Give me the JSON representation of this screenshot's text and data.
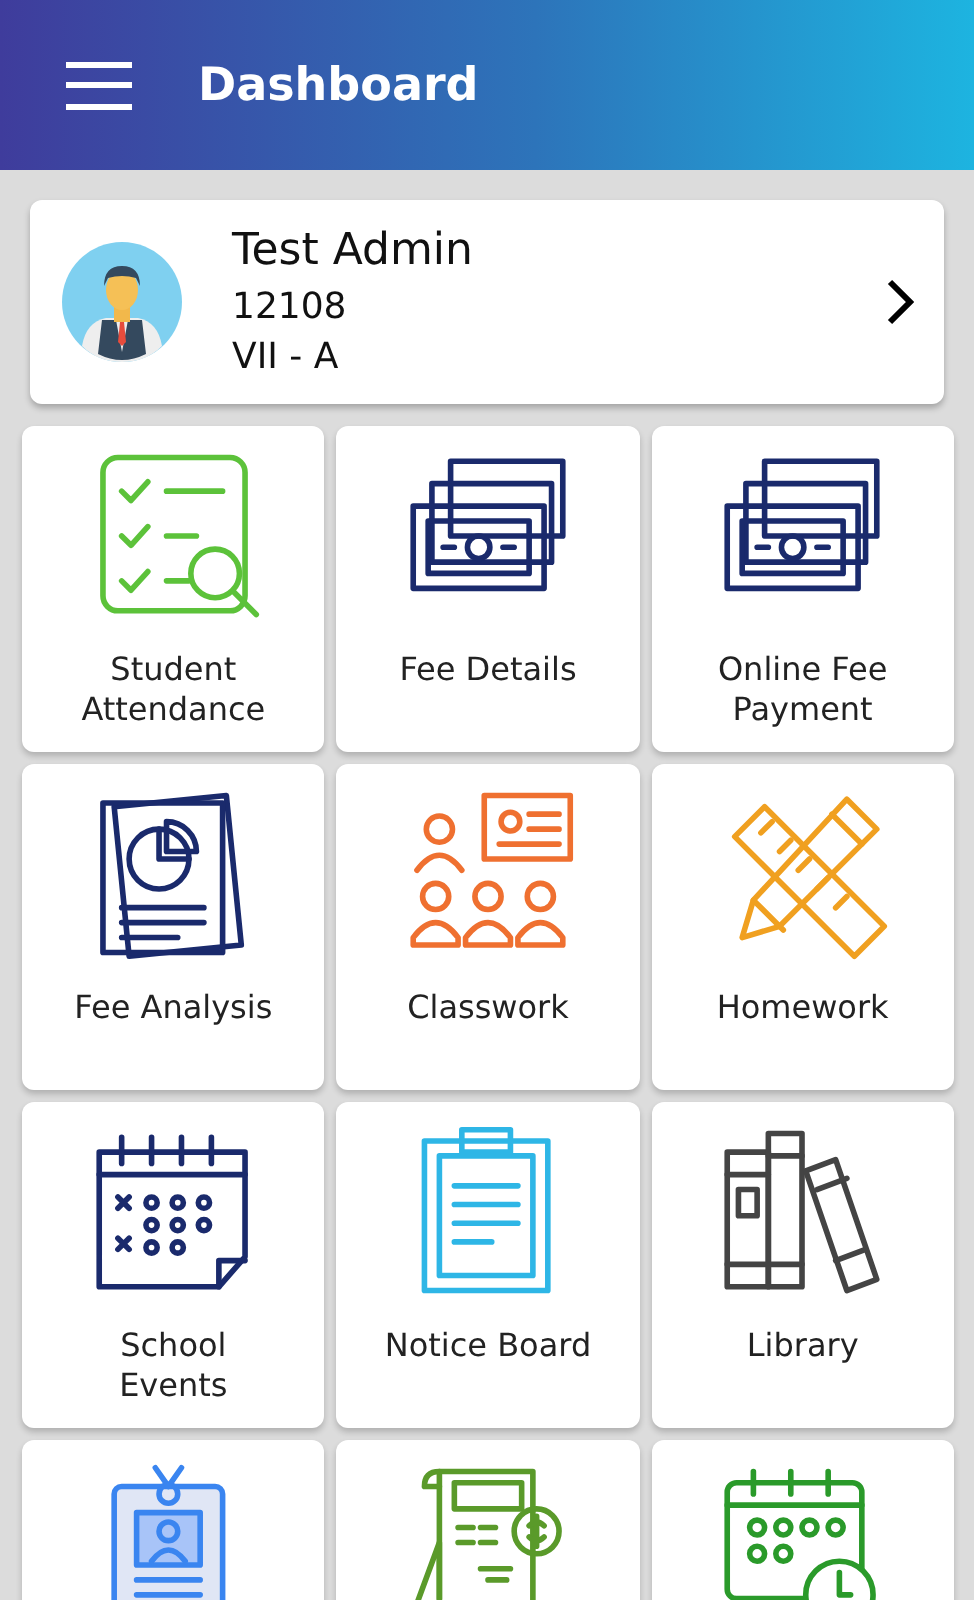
{
  "app_bar": {
    "title": "Dashboard"
  },
  "profile": {
    "name": "Test Admin",
    "id": "12108",
    "class": "VII - A"
  },
  "tiles": [
    {
      "kind": "attendance",
      "label": "Student Attendance"
    },
    {
      "kind": "cash",
      "label": "Fee Details"
    },
    {
      "kind": "cash",
      "label": "Online Fee Payment"
    },
    {
      "kind": "report",
      "label": "Fee Analysis"
    },
    {
      "kind": "class",
      "label": "Classwork"
    },
    {
      "kind": "tools",
      "label": "Homework"
    },
    {
      "kind": "calendar",
      "label": "School Events"
    },
    {
      "kind": "clipboard",
      "label": "Notice Board"
    },
    {
      "kind": "books",
      "label": "Library"
    },
    {
      "kind": "badge"
    },
    {
      "kind": "bill"
    },
    {
      "kind": "schedule"
    }
  ]
}
